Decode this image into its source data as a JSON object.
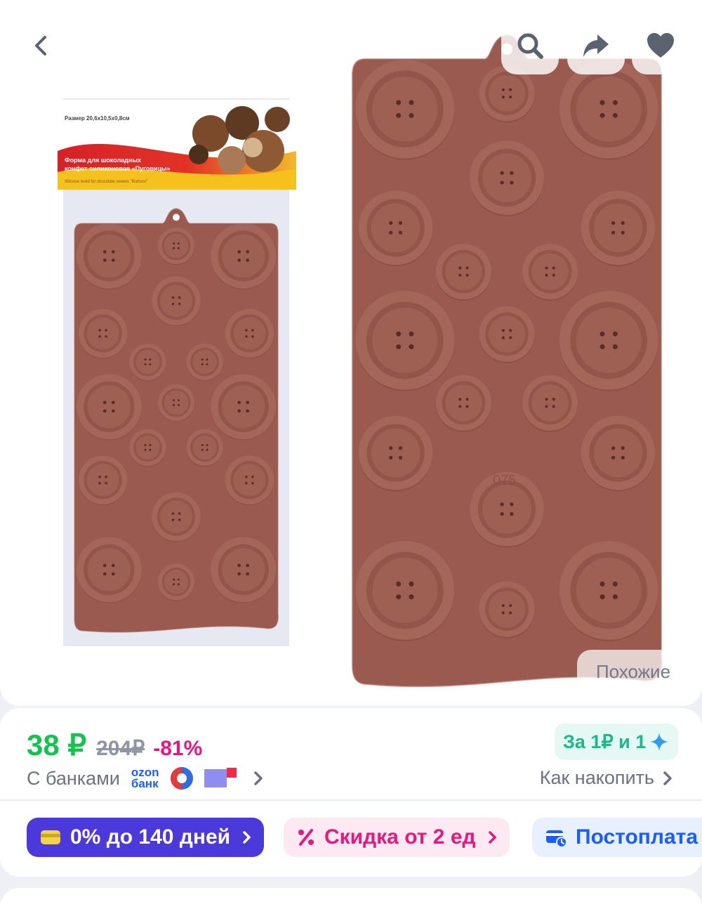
{
  "gallery": {
    "image_alt": "Силиконовая форма для шоколада «Пуговицы»",
    "package": {
      "article": "Арт. VL80-336",
      "size": "Размер 20,6х10,5х0,8см",
      "title_line1": "Форма для шоколадных",
      "title_line2": "конфет силиконовая «Пуговицы»",
      "subtitle": "Silicone mold for chocolate sweets \"Buttons\""
    },
    "mold_number": "075",
    "similar_label": "Похожие"
  },
  "top_bar": {
    "back_icon": "chevron-left-icon",
    "search_icon": "search-icon",
    "share_icon": "share-arrow-icon",
    "favorite_icon": "heart-icon"
  },
  "price": {
    "current": "38 ₽",
    "old": "204₽",
    "discount": "-81%",
    "points_badge": "За 1₽ и 1",
    "banks_label": "С банками",
    "ozon_bank_line1": "ozon",
    "ozon_bank_line2": "банк",
    "save_link": "Как накопить"
  },
  "chips": [
    {
      "label": "0% до 140 дней",
      "icon": "card-icon"
    },
    {
      "label": "Скидка от 2 ед",
      "icon": "percent-icon"
    },
    {
      "label": "Постоплата",
      "icon": "wallet-icon"
    }
  ],
  "colors": {
    "mold": "#9a5a4f",
    "price_green": "#10c44c",
    "discount_pink": "#f1117e",
    "credit_purple": "#4b39db",
    "ozon_blue": "#1a5dff"
  }
}
